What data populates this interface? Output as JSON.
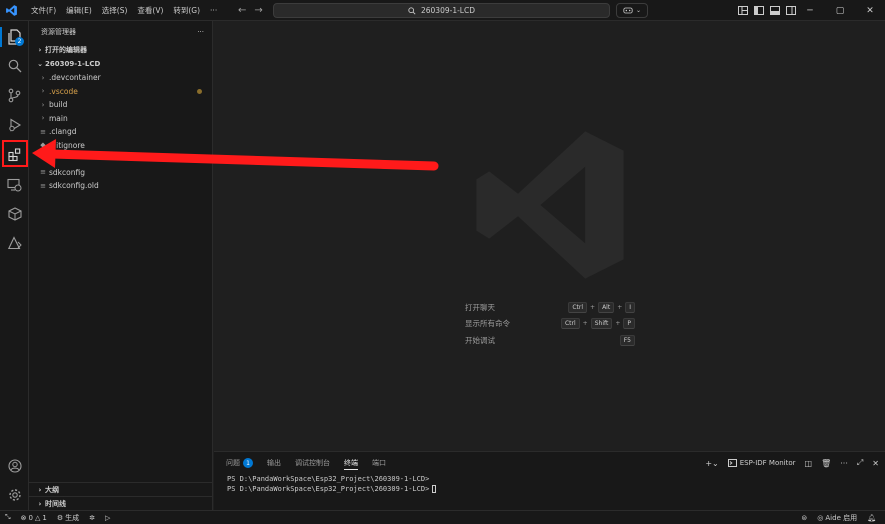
{
  "titlebar": {
    "menu": [
      "文件(F)",
      "编辑(E)",
      "选择(S)",
      "查看(V)",
      "转到(G)",
      "···"
    ],
    "search_text": "260309-1-LCD",
    "window_controls": [
      "minimize-icon",
      "restore-icon",
      "close-icon"
    ]
  },
  "activitybar": {
    "icons": [
      "explorer-icon",
      "search-icon",
      "source-control-icon",
      "run-debug-icon",
      "extensions-icon",
      "remote-explorer-icon",
      "package-icon",
      "esp-idf-icon"
    ],
    "bottom_icons": [
      "account-icon",
      "settings-gear-icon"
    ],
    "explorer_badge": "2"
  },
  "sidebar": {
    "title": "资源管理器",
    "more": "···",
    "open_editors": "打开的编辑器",
    "folder": "260309-1-LCD",
    "tree": [
      {
        "type": "folder",
        "name": ".devcontainer"
      },
      {
        "type": "folder",
        "name": ".vscode",
        "modified": true
      },
      {
        "type": "folder",
        "name": "build"
      },
      {
        "type": "folder",
        "name": "main"
      },
      {
        "type": "file",
        "name": ".clangd"
      },
      {
        "type": "file",
        "name": ".gitignore"
      },
      {
        "type": "file",
        "name": ""
      },
      {
        "type": "file",
        "name": "sdkconfig"
      },
      {
        "type": "file",
        "name": "sdkconfig.old"
      }
    ],
    "outline": "大纲",
    "timeline": "时间线"
  },
  "editor": {
    "shortcuts": [
      {
        "label": "打开聊天",
        "keys": [
          "Ctrl",
          "Alt",
          "I"
        ]
      },
      {
        "label": "显示所有命令",
        "keys": [
          "Ctrl",
          "Shift",
          "P"
        ]
      },
      {
        "label": "开始调试",
        "keys": [
          "F5"
        ]
      }
    ]
  },
  "panel": {
    "tabs": [
      {
        "label": "问题",
        "badge": "1"
      },
      {
        "label": "输出"
      },
      {
        "label": "调试控制台"
      },
      {
        "label": "终端",
        "active": true
      },
      {
        "label": "端口"
      }
    ],
    "terminal_label": "ESP-IDF Monitor",
    "terminal_lines": [
      "PS D:\\PandaWorkSpace\\Esp32_Project\\260309-1-LCD>",
      "PS D:\\PandaWorkSpace\\Esp32_Project\\260309-1-LCD>"
    ]
  },
  "statusbar": {
    "errors": "0",
    "warnings": "1",
    "build": "生成",
    "right_label": "Aide 启用"
  },
  "colors": {
    "accent": "#0078d4",
    "annotation": "#ff1a1a",
    "modified": "#d7a14b"
  }
}
